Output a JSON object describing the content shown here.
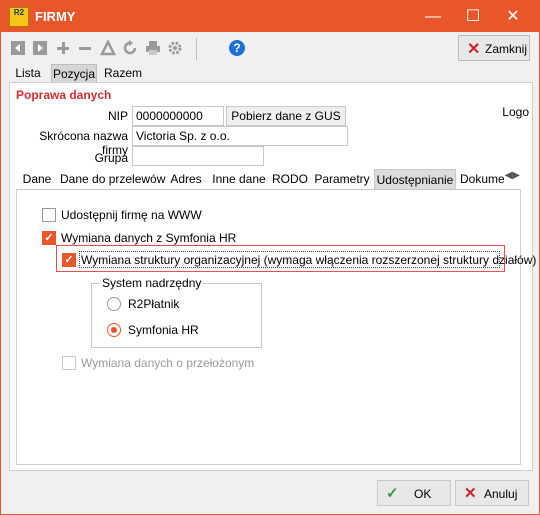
{
  "window": {
    "title": "FIRMY",
    "app_icon_text": "R2",
    "minimize_glyph": "—",
    "maximize_glyph": "☐",
    "close_glyph": "✕"
  },
  "toolbar": {
    "icons": [
      "first-icon",
      "next-icon",
      "add-icon",
      "remove-icon",
      "edit-icon",
      "refresh-icon",
      "print-icon",
      "settings-icon",
      "help-icon"
    ],
    "close_label": "Zamknij"
  },
  "top_tabs": [
    {
      "label": "Lista",
      "active": false
    },
    {
      "label": "Pozycja",
      "active": true
    },
    {
      "label": "Razem",
      "active": false
    }
  ],
  "form": {
    "section_title": "Poprawa danych",
    "logo_label": "Logo",
    "nip_label": "NIP",
    "nip_value": "0000000000",
    "gus_button": "Pobierz dane z GUS",
    "short_name_label": "Skrócona nazwa firmy",
    "short_name_value": "Victoria Sp. z o.o.",
    "group_label": "Grupa",
    "group_value": ""
  },
  "inner_tabs": [
    {
      "label": "Dane",
      "active": false
    },
    {
      "label": "Dane do przelewów",
      "active": false
    },
    {
      "label": "Adres",
      "active": false
    },
    {
      "label": "Inne dane",
      "active": false
    },
    {
      "label": "RODO",
      "active": false
    },
    {
      "label": "Parametry",
      "active": false
    },
    {
      "label": "Udostępnianie",
      "active": true
    },
    {
      "label": "Dokumen",
      "active": false
    }
  ],
  "sharing": {
    "share_www": {
      "label": "Udostępnij firmę na WWW",
      "checked": false
    },
    "exchange_hr": {
      "label": "Wymiana danych z Symfonia HR",
      "checked": true
    },
    "org_structure": {
      "label": "Wymiana struktury organizacyjnej (wymaga włączenia rozszerzonej struktury działów)",
      "checked": true
    },
    "parent_system": {
      "title": "System nadrzędny",
      "options": [
        {
          "label": "R2Płatnik",
          "selected": false
        },
        {
          "label": "Symfonia HR",
          "selected": true
        }
      ]
    },
    "supervisor": {
      "label": "Wymiana danych o przełożonym",
      "checked": false,
      "disabled": true
    }
  },
  "footer": {
    "ok_label": "OK",
    "cancel_label": "Anuluj"
  },
  "colors": {
    "accent": "#e8562a",
    "section_title": "#d32f2f",
    "ok_icon": "#3a9a3a",
    "cancel_icon": "#c62828"
  }
}
